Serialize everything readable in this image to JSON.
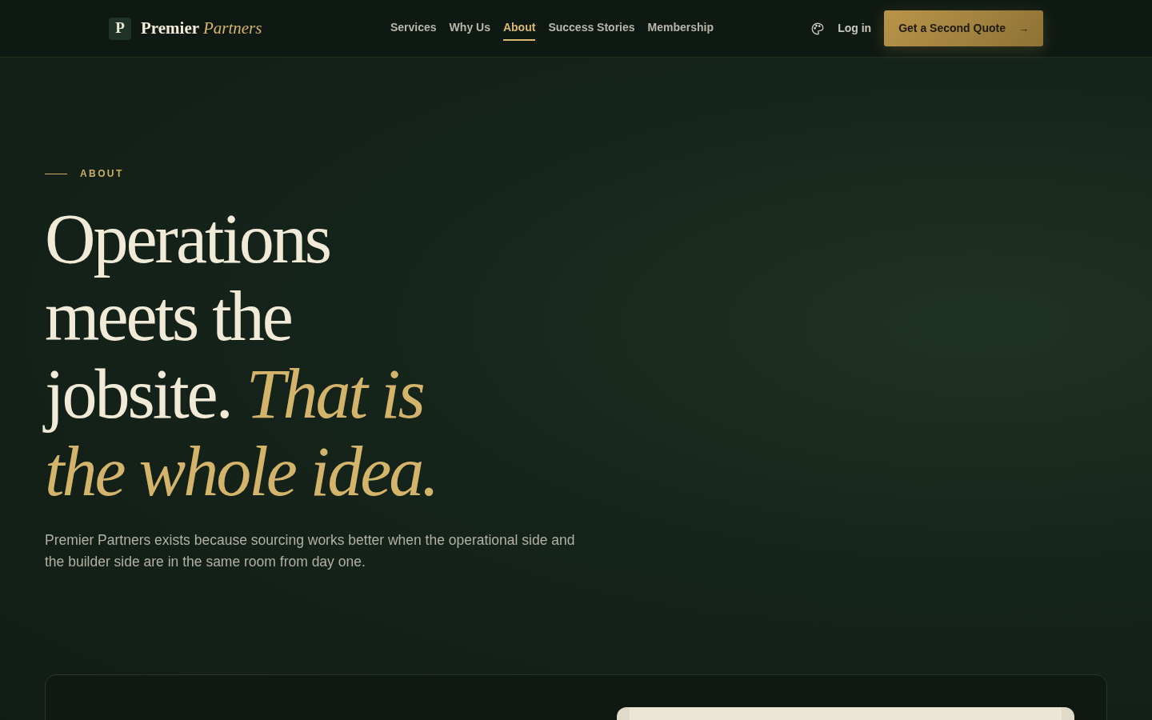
{
  "brand": {
    "mark": "P",
    "name": "Premier",
    "accent": "Partners"
  },
  "nav": [
    {
      "label": "Services",
      "selected": false
    },
    {
      "label": "Why Us",
      "selected": false
    },
    {
      "label": "About",
      "selected": true
    },
    {
      "label": "Success Stories",
      "selected": false
    },
    {
      "label": "Membership",
      "selected": false
    }
  ],
  "login": "Log in",
  "cta": {
    "label": "Get a Second Quote",
    "arrow": "→"
  },
  "hero": {
    "eyebrow": "ABOUT",
    "lines": [
      "Operations",
      "meets the",
      "jobsite. *That is*",
      "*the whole idea.*"
    ],
    "lead": "Premier Partners exists because sourcing works better when the operational side and the builder side are in the same room from day one."
  }
}
